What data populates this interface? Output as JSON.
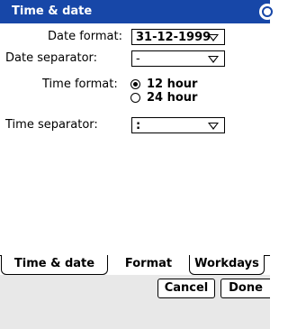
{
  "title": "Time & date",
  "date_format": {
    "label": "Date format:",
    "value": "31-12-1999"
  },
  "date_separator": {
    "label": "Date separator:",
    "value": "-"
  },
  "time_format": {
    "label": "Time format:",
    "options": [
      {
        "label": "12 hour",
        "selected": true
      },
      {
        "label": "24 hour",
        "selected": false
      }
    ]
  },
  "time_separator": {
    "label": "Time separator:",
    "value": ":"
  },
  "tabs": [
    {
      "label": "Time & date",
      "active": false
    },
    {
      "label": "Format",
      "active": true
    },
    {
      "label": "Workdays",
      "active": false
    }
  ],
  "buttons": {
    "cancel": "Cancel",
    "done": "Done"
  },
  "colors": {
    "titlebar": "#1747a8",
    "bottombar": "#e8e8e8"
  },
  "icons": {
    "corner": "circle-button-icon",
    "dropdown": "chevron-down-icon"
  }
}
